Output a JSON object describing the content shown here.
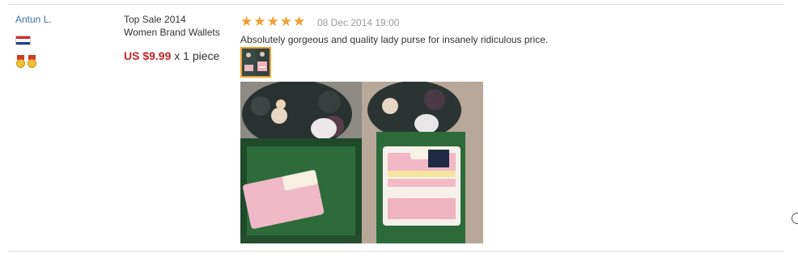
{
  "buyer": {
    "name": "Antun L.",
    "flag_icon": "croatia-flag-icon",
    "badge_icon": "medal-icon",
    "badge_count": 2
  },
  "product": {
    "title_line1": "Top Sale 2014",
    "title_line2": "Women Brand Wallets",
    "price": "US $9.99",
    "quantity": "x 1 piece"
  },
  "review": {
    "rating": 5,
    "rating_max": 5,
    "date": "08 Dec 2014 19:00",
    "text": "Absolutely gorgeous and quality lady purse for insanely ridiculous price."
  },
  "colors": {
    "link": "#3a6fa8",
    "price": "#c0282d",
    "star": "#f0a030",
    "date": "#9a9a9a"
  }
}
